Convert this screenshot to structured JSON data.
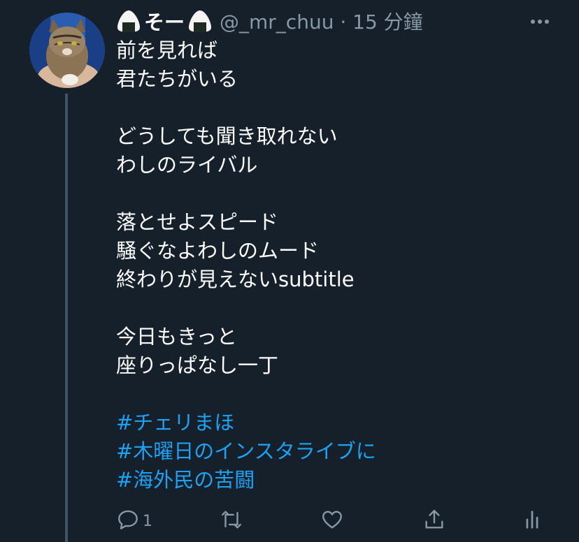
{
  "tweet": {
    "author": {
      "display_name": "そー",
      "handle": "@_mr_chuu",
      "timestamp": "15 分鐘",
      "name_emoji": "rice-ball-icon",
      "avatar": "cat-photo-avatar"
    },
    "lines": [
      "前を見れば",
      "君たちがいる",
      "",
      "どうしても聞き取れない",
      "わしのライバル",
      "",
      "落とせよスピード",
      "騒ぐなよわしのムード",
      "終わりが見えないsubtitle",
      "",
      "今日もきっと",
      "座りっぱなし一丁",
      ""
    ],
    "hashtags": [
      "#チェリまほ",
      "#木曜日のインスタライブに",
      "#海外民の苦闘"
    ],
    "actions": {
      "reply_count": "1",
      "icons": [
        "reply-icon",
        "retweet-icon",
        "like-icon",
        "share-icon",
        "analytics-icon"
      ]
    }
  },
  "colors": {
    "background": "#15202b",
    "text": "#ffffff",
    "secondary": "#8899a6",
    "link": "#1da1f2",
    "thread_line": "#3d5466"
  }
}
